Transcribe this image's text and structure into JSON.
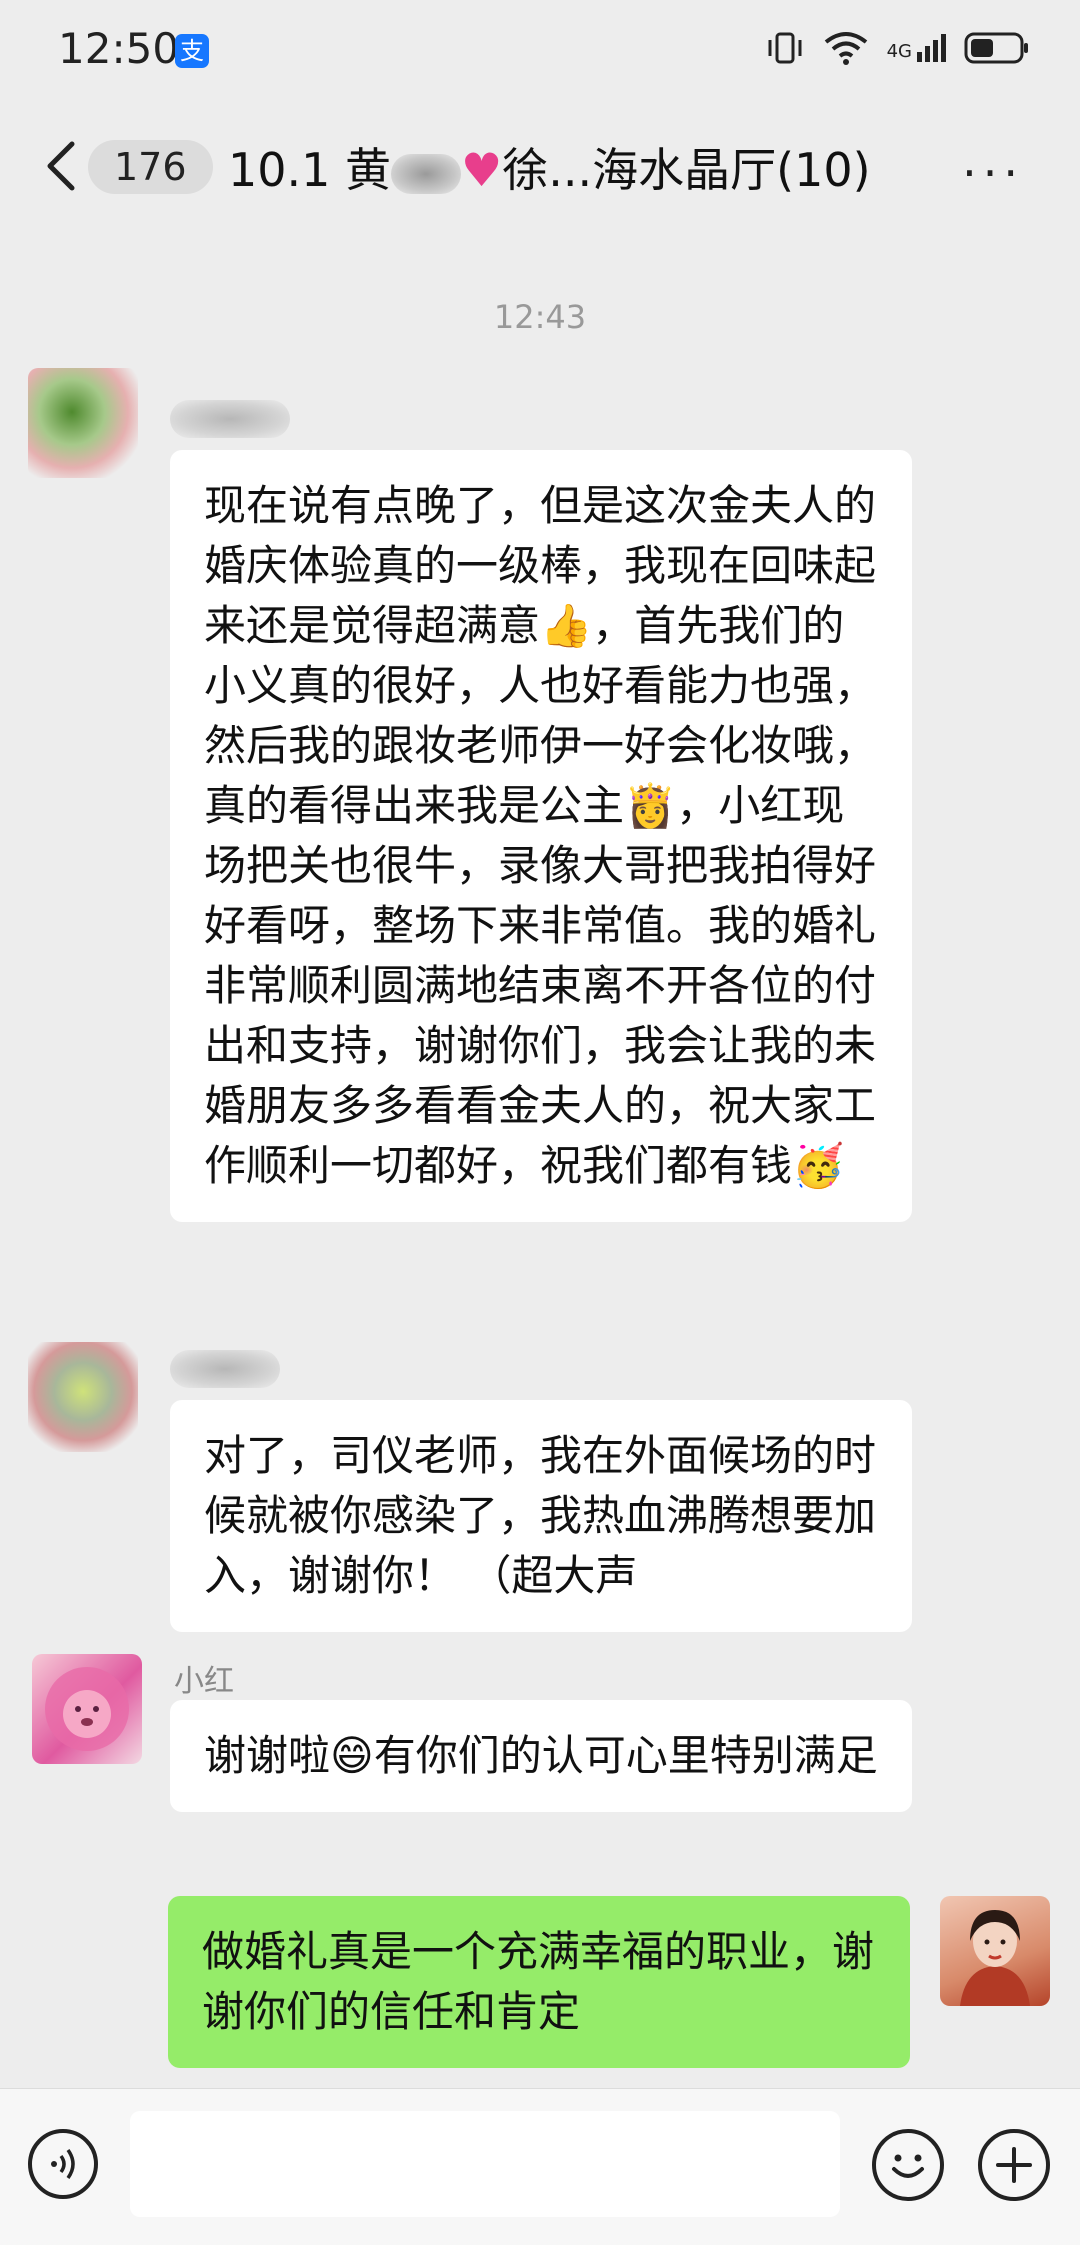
{
  "status_bar": {
    "time": "12:50",
    "alipay_icon": "支",
    "signal_label": "4G",
    "icons": [
      "vibrate-icon",
      "wifi-icon",
      "signal-icon",
      "battery-icon"
    ]
  },
  "header": {
    "unread_count": "176",
    "title_prefix": "10.1 黄",
    "title_suffix": "徐...海水晶厅(10)",
    "more_label": "···"
  },
  "chat": {
    "timestamp": "12:43",
    "messages": [
      {
        "sender": "",
        "text": "现在说有点晚了，但是这次金夫人的婚庆体验真的一级棒，我现在回味起来还是觉得超满意👍，首先我们的小义真的很好，人也好看能力也强，然后我的跟妆老师伊一好会化妆哦，真的看得出来我是公主👸，小红现场把关也很牛，录像大哥把我拍得好好看呀，整场下来非常值。我的婚礼非常顺利圆满地结束离不开各位的付出和支持，谢谢你们，我会让我的未婚朋友多多看看金夫人的，祝大家工作顺利一切都好，祝我们都有钱🥳"
      },
      {
        "sender": "",
        "text": "对了，司仪老师，我在外面候场的时候就被你感染了，我热血沸腾想要加入，谢谢你！ （超大声"
      },
      {
        "sender": "小红",
        "text": "谢谢啦😄有你们的认可心里特别满足"
      },
      {
        "sender": "",
        "text": "做婚礼真是一个充满幸福的职业，谢谢你们的信任和肯定"
      }
    ]
  },
  "input_bar": {
    "placeholder": "",
    "icons": [
      "voice-icon",
      "emoji-icon",
      "plus-icon"
    ]
  },
  "colors": {
    "background": "#ededed",
    "bubble_other": "#ffffff",
    "bubble_self": "#95ec69"
  }
}
